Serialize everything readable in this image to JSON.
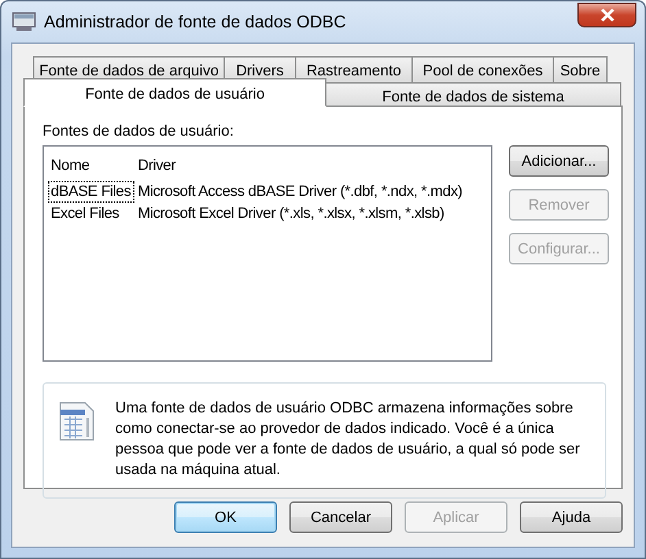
{
  "window": {
    "title": "Administrador de fonte de dados ODBC"
  },
  "tab_rows": [
    {
      "tabs": [
        {
          "label": "Fonte de dados de arquivo",
          "selected": false
        },
        {
          "label": "Drivers",
          "selected": false
        },
        {
          "label": "Rastreamento",
          "selected": false
        },
        {
          "label": "Pool de conexões",
          "selected": false
        },
        {
          "label": "Sobre",
          "selected": false
        }
      ]
    },
    {
      "tabs": [
        {
          "label": "Fonte de dados de usuário",
          "selected": true
        },
        {
          "label": "Fonte de dados de sistema",
          "selected": false
        }
      ]
    }
  ],
  "list_label": "Fontes de dados de usuário:",
  "table": {
    "columns": [
      "Nome",
      "Driver"
    ],
    "rows": [
      {
        "cells": [
          "dBASE Files",
          "Microsoft Access dBASE Driver (*.dbf, *.ndx, *.mdx)"
        ],
        "focused": true
      },
      {
        "cells": [
          "Excel Files",
          "Microsoft Excel Driver (*.xls, *.xlsx, *.xlsm, *.xlsb)"
        ],
        "focused": false
      }
    ]
  },
  "side_buttons": [
    {
      "label": "Adicionar...",
      "disabled": false
    },
    {
      "label": "Remover",
      "disabled": true
    },
    {
      "label": "Configurar...",
      "disabled": true
    }
  ],
  "info": "Uma fonte de dados de usuário ODBC armazena informações sobre como conectar-se ao provedor de dados indicado. Você é a única pessoa que pode ver a fonte de dados de usuário, a qual só pode ser usada na máquina atual.",
  "buttons": [
    {
      "label": "OK",
      "disabled": false,
      "default": true
    },
    {
      "label": "Cancelar",
      "disabled": false,
      "default": false
    },
    {
      "label": "Aplicar",
      "disabled": true,
      "default": false
    },
    {
      "label": "Ajuda",
      "disabled": false,
      "default": false
    }
  ]
}
